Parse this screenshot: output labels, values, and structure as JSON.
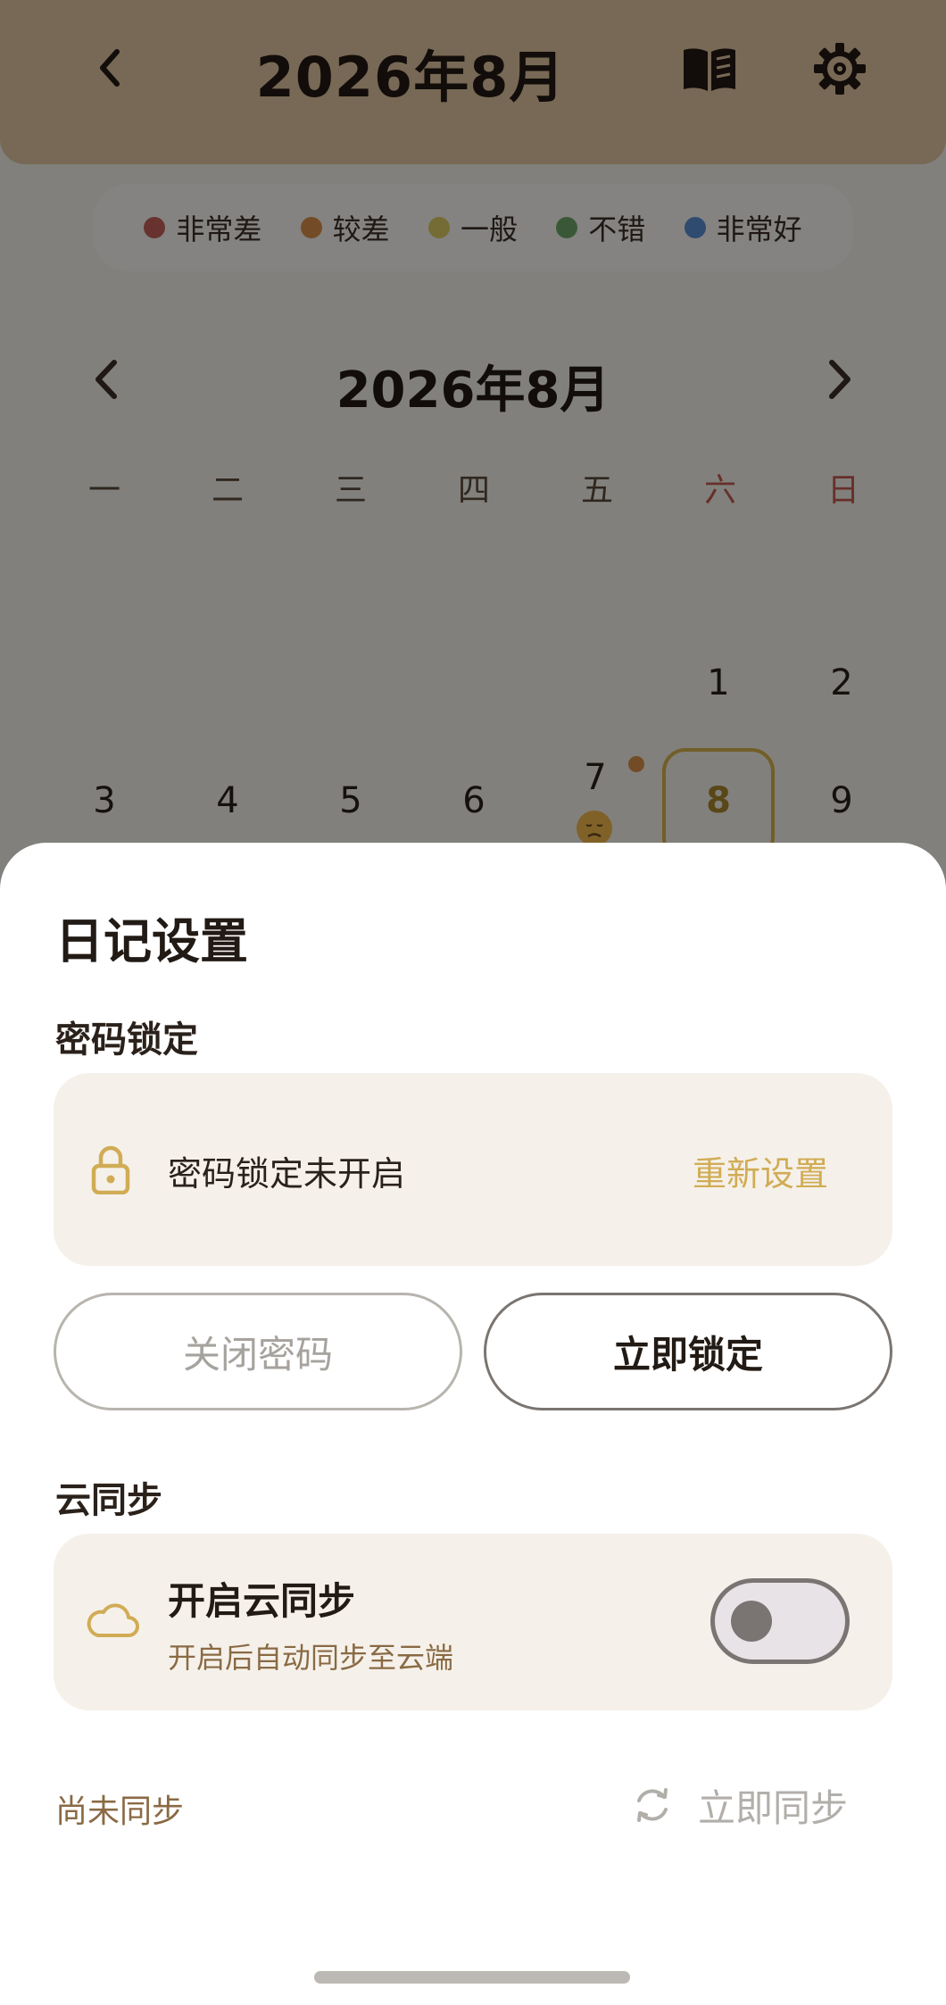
{
  "header": {
    "title": "2026年8月",
    "back_icon": "chevron-left-icon",
    "book_icon": "book-open-icon",
    "settings_icon": "gear-icon"
  },
  "legend": [
    {
      "label": "非常差",
      "color": "#c4605a"
    },
    {
      "label": "较差",
      "color": "#d9904a"
    },
    {
      "label": "一般",
      "color": "#dccc62"
    },
    {
      "label": "不错",
      "color": "#6fa66b"
    },
    {
      "label": "非常好",
      "color": "#5b8ed4"
    }
  ],
  "calendar": {
    "month_title": "2026年8月",
    "weekdays": [
      "一",
      "二",
      "三",
      "四",
      "五",
      "六",
      "日"
    ],
    "week1": [
      "1",
      "2"
    ],
    "week2": [
      "3",
      "4",
      "5",
      "6",
      "7",
      "8",
      "9"
    ],
    "today": "8",
    "mood_day": "7"
  },
  "sheet": {
    "title": "日记设置",
    "password_section": {
      "label": "密码锁定",
      "status": "密码锁定未开启",
      "reset_label": "重新设置",
      "disable_button": "关闭密码",
      "lock_now_button": "立即锁定"
    },
    "cloud_section": {
      "label": "云同步",
      "title": "开启云同步",
      "subtitle": "开启后自动同步至云端",
      "enabled": false
    },
    "sync_status": "尚未同步",
    "sync_now_label": "立即同步"
  },
  "colors": {
    "accent": "#d1ac55",
    "header_bg": "#e0c6a0",
    "sheet_bg": "#ffffff",
    "card_bg": "#f5f1ea"
  }
}
